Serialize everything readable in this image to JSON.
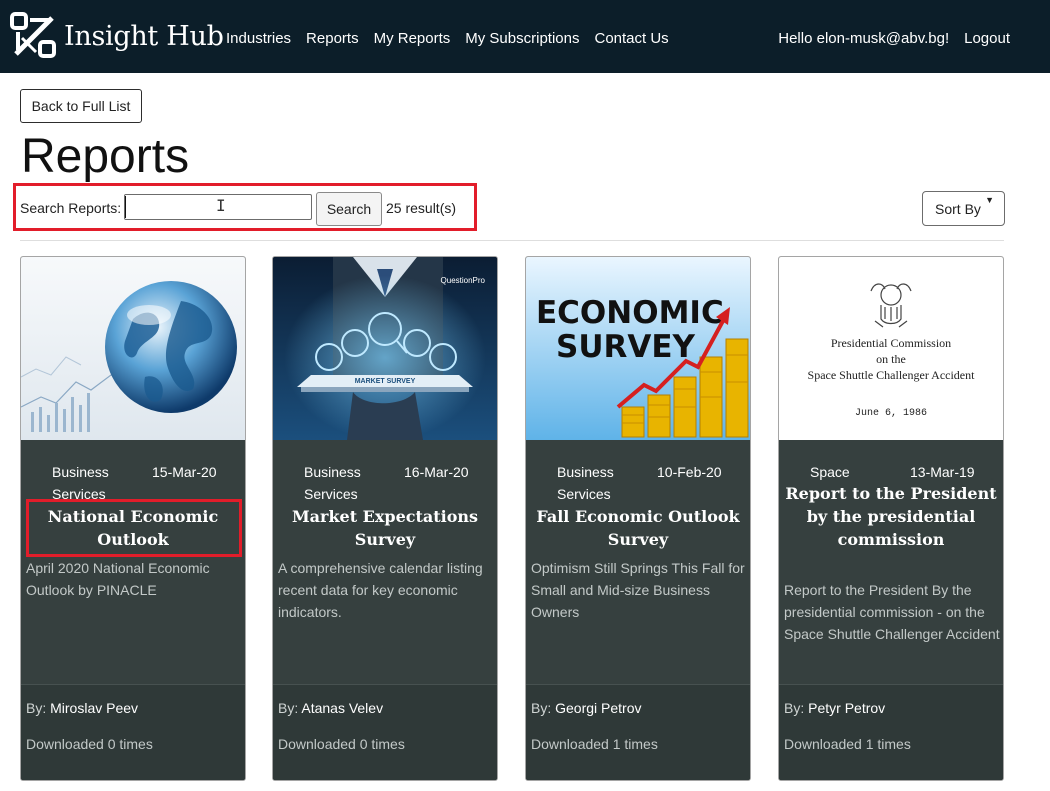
{
  "navbar": {
    "brand": "Insight Hub",
    "links": [
      "Industries",
      "Reports",
      "My Reports",
      "My Subscriptions",
      "Contact Us"
    ],
    "greeting": "Hello elon-musk@abv.bg!",
    "logout": "Logout"
  },
  "page": {
    "back_button": "Back to Full List",
    "title": "Reports"
  },
  "search": {
    "label": "Search Reports:",
    "value": "",
    "button": "Search",
    "result_count": "25 result(s)"
  },
  "sort": {
    "label": "Sort By"
  },
  "reports": [
    {
      "industry": "Business Services",
      "date": "15-Mar-20",
      "title": "National Economic Outlook",
      "description": "April 2020 National Economic Outlook by PINACLE",
      "by_label": "By:",
      "author": "Miroslav Peev",
      "downloads": "Downloaded 0 times",
      "image_icon": "globe-chart-thumbnail"
    },
    {
      "industry": "Business Services",
      "date": "16-Mar-20",
      "title": "Market Expectations Survey",
      "description": "A comprehensive calendar listing recent data for key economic indicators.",
      "by_label": "By:",
      "author": "Atanas Velev",
      "downloads": "Downloaded 0 times",
      "image_icon": "tablet-survey-thumbnail",
      "image_caption": "MARKET SURVEY",
      "image_brand": "QuestionPro"
    },
    {
      "industry": "Business Services",
      "date": "10-Feb-20",
      "title": "Fall Economic Outlook Survey",
      "description": "Optimism Still Springs This Fall for Small and Mid-size Business Owners",
      "by_label": "By:",
      "author": "Georgi Petrov",
      "downloads": "Downloaded 1 times",
      "image_icon": "economic-survey-thumbnail",
      "image_heading_1": "ECONOMIC",
      "image_heading_2": "SURVEY"
    },
    {
      "industry": "Space",
      "date": "13-Mar-19",
      "title": "Report to the President by the presidential commission",
      "description": "Report to the President By the presidential commission - on the Space Shuttle Challenger Accident",
      "by_label": "By:",
      "author": "Petyr Petrov",
      "downloads": "Downloaded 1 times",
      "image_icon": "document-seal-thumbnail",
      "image_line_1": "Presidential Commission",
      "image_line_2": "on the",
      "image_line_3": "Space Shuttle Challenger Accident",
      "image_line_4": "June 6, 1986"
    }
  ],
  "colors": {
    "navbar": "#0c1e29",
    "card": "#36403f",
    "card_footer": "#2f3938",
    "highlight": "#e21d2a"
  }
}
